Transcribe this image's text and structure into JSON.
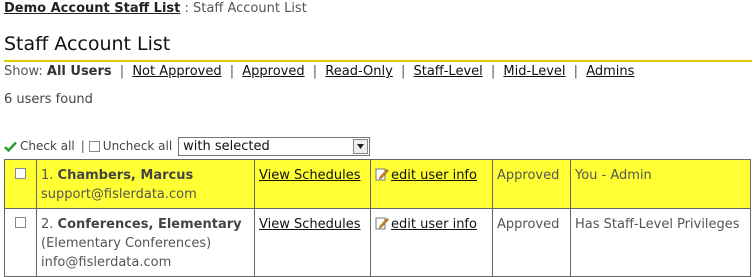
{
  "breadcrumb": {
    "parent": "Demo Account Staff List",
    "separator": ":",
    "current": "Staff Account List"
  },
  "page_title": "Staff Account List",
  "filter": {
    "label": "Show:",
    "current": "All Users",
    "links": [
      "Not Approved",
      "Approved",
      "Read-Only",
      "Staff-Level",
      "Mid-Level",
      "Admins"
    ],
    "separator": "|"
  },
  "users_found": "6 users found",
  "bulk": {
    "check_all": "Check all",
    "divider": "|",
    "uncheck_all": "Uncheck all",
    "select_value": "with selected"
  },
  "rows": [
    {
      "number": "1.",
      "name": "Chambers, Marcus",
      "display_name": "",
      "email": "support@fislerdata.com",
      "schedules": "View Schedules",
      "edit": "edit user info",
      "status": "Approved",
      "role": "You - Admin"
    },
    {
      "number": "2.",
      "name": "Conferences, Elementary",
      "display_name": "(Elementary Conferences)",
      "email": "info@fislerdata.com",
      "schedules": "View Schedules",
      "edit": "edit user info",
      "status": "Approved",
      "role": "Has Staff-Level Privileges"
    }
  ],
  "colors": {
    "highlight_row": "#ffff33",
    "title_rule": "#e6c800",
    "check_icon": "#2e9b2e"
  },
  "icons": {
    "check_all": "green-checkmark-icon",
    "edit": "pencil-note-icon",
    "dropdown": "triangle-down-icon"
  }
}
